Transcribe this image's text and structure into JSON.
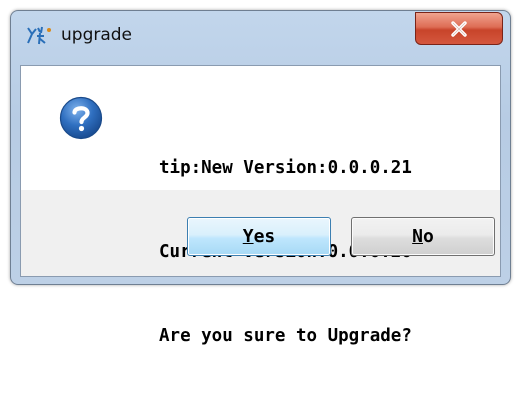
{
  "window": {
    "title": "upgrade",
    "close_glyph": "x"
  },
  "dialog": {
    "icon": "question-icon",
    "message_lines": [
      "tip:New Version:0.0.0.21",
      "Current Version:0.0.0.20",
      "Are you sure to Upgrade?"
    ]
  },
  "buttons": {
    "yes": {
      "accel": "Y",
      "rest": "es"
    },
    "no": {
      "accel": "N",
      "rest": "o"
    }
  },
  "colors": {
    "close_button": "#c8442a",
    "question_icon": "#1f5fae",
    "frame": "#bdd0e6"
  }
}
